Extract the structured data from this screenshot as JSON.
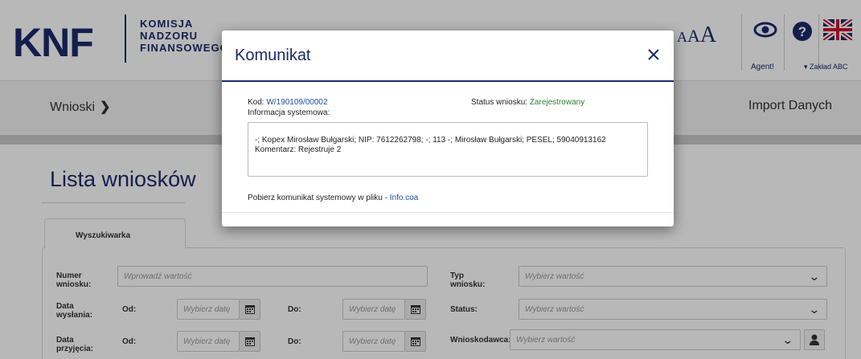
{
  "header": {
    "logo_main": "KNF",
    "logo_lines": [
      "KOMISJA",
      "NADZORU",
      "FINANSOWEGO"
    ],
    "font_size_labels": [
      "A",
      "A",
      "A"
    ],
    "user_label": "Agent!",
    "org_label": "Zakład ABC",
    "icons": [
      "eye-icon",
      "help-icon",
      "uk-flag-icon"
    ]
  },
  "nav": {
    "left": "Wnioski",
    "right": "Import Danych"
  },
  "page": {
    "title": "Lista wniosków",
    "tab_label": "Wyszukiwarka"
  },
  "search_form": {
    "numer_label": "Numer wniosku:",
    "numer_placeholder": "Wprowadź wartość",
    "data_wyslania_label": "Data wysłania:",
    "data_przyjecia_label": "Data przyjęcia:",
    "od_label": "Od:",
    "do_label": "Do:",
    "date_placeholder": "Wybierz datę",
    "typ_label": "Typ wniosku:",
    "status_label": "Status:",
    "wnioskodawca_label": "Wnioskodawca:",
    "select_placeholder": "Wybierz wartość"
  },
  "modal": {
    "title": "Komunikat",
    "kod_label": "Kod:",
    "kod_value": "W/190109/00002",
    "status_label": "Status wniosku:",
    "status_value": "Zarejestrowany",
    "info_label": "Informacja systemowa:",
    "info_text": "-; Kopex Mirosław Bułgarski; NIP: 7612262798; -; 113 -; Mirosław Bułgarski; PESEL; 59040913162 Komentarz: Rejestruje 2",
    "download_text": "Pobierz komunikat systemowy w pliku -",
    "download_link": "Info.coa"
  },
  "colors": {
    "brand": "#1b2a6b",
    "link": "#1f4ea1",
    "status_ok": "#2e7d32"
  }
}
